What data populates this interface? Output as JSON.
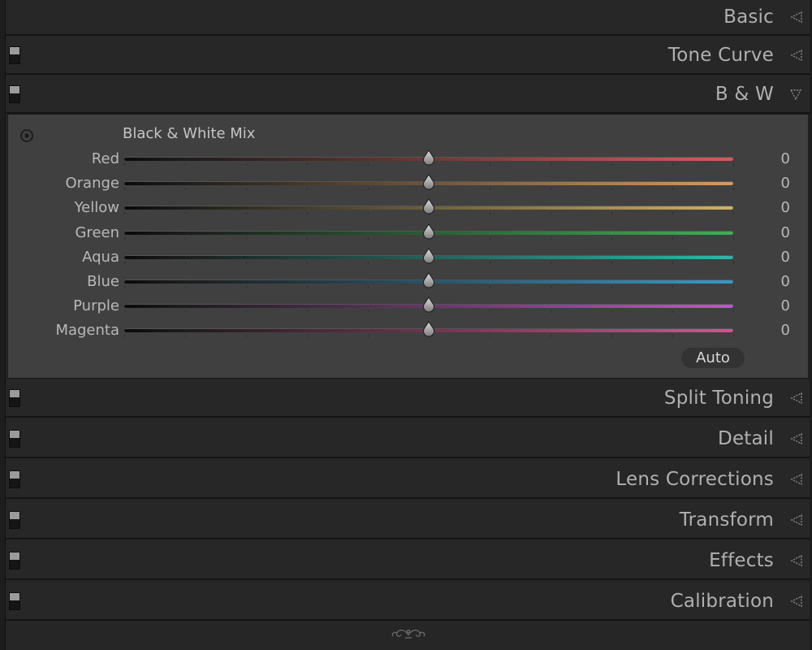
{
  "panels": {
    "basic": {
      "title": "Basic"
    },
    "tone_curve": {
      "title": "Tone Curve"
    },
    "bw": {
      "title": "B & W"
    },
    "split_toning": {
      "title": "Split Toning"
    },
    "detail": {
      "title": "Detail"
    },
    "lens_corrections": {
      "title": "Lens Corrections"
    },
    "transform": {
      "title": "Transform"
    },
    "effects": {
      "title": "Effects"
    },
    "calibration": {
      "title": "Calibration"
    }
  },
  "bw_mix": {
    "title": "Black & White Mix",
    "auto_label": "Auto",
    "sliders": [
      {
        "label": "Red",
        "value": "0",
        "color": "#d85a5a"
      },
      {
        "label": "Orange",
        "value": "0",
        "color": "#d99a5c"
      },
      {
        "label": "Yellow",
        "value": "0",
        "color": "#cfb063"
      },
      {
        "label": "Green",
        "value": "0",
        "color": "#3fae55"
      },
      {
        "label": "Aqua",
        "value": "0",
        "color": "#2db8a8"
      },
      {
        "label": "Blue",
        "value": "0",
        "color": "#3a97c4"
      },
      {
        "label": "Purple",
        "value": "0",
        "color": "#c157c4"
      },
      {
        "label": "Magenta",
        "value": "0",
        "color": "#d3538f"
      }
    ]
  },
  "icons": {
    "panel_switch": "panel-toggle-switch-icon",
    "collapsed": "triangle-left-icon",
    "expanded": "triangle-down-icon",
    "target": "target-adjustment-icon",
    "footer": "ornament-icon"
  }
}
